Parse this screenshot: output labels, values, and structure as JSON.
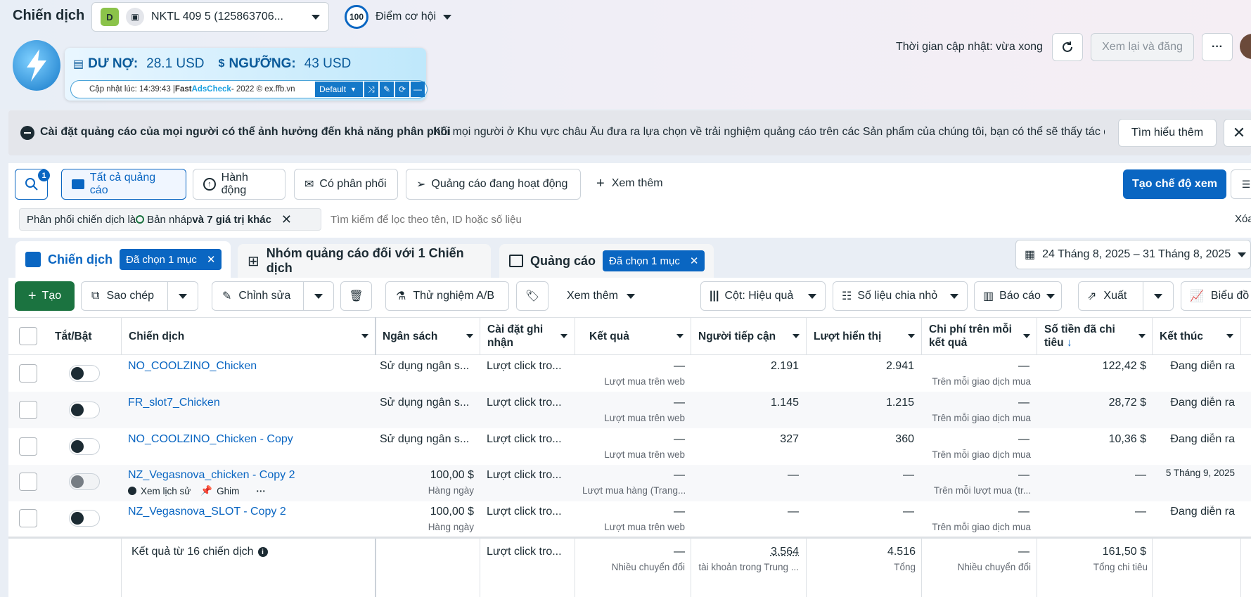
{
  "header": {
    "title": "Chiến dịch",
    "account_badge": "D",
    "account_name": "NKTL 409 5 (125863706...",
    "score_value": "100",
    "score_label": "Điểm cơ hội",
    "update_time": "Thời gian cập nhật: vừa xong",
    "review_button": "Xem lại và đăng"
  },
  "adscheck": {
    "debt_label": "DƯ NỢ:",
    "debt_value": "28.1 USD",
    "threshold_label": "NGƯỠNG:",
    "threshold_value": "43 USD",
    "updated_text": "Cập nhật lúc: 14:39:43 | ",
    "brand_fast": "Fast ",
    "brand_name": "AdsCheck",
    "brand_tail": " - 2022 © ex.ffb.vn",
    "mode": "Default"
  },
  "notice": {
    "title": "Cài đặt quảng cáo của mọi người có thể ảnh hưởng đến khả năng phân phối",
    "text": "Khi mọi người ở Khu vực châu Âu đưa ra lựa chọn về trải nghiệm quảng cáo trên các Sản phẩm của chúng tôi, bạn có thể sẽ thấy tác đ...",
    "learn_more": "Tìm hiểu thêm"
  },
  "filters": {
    "search_badge": "1",
    "all_ads": "Tất cả quảng cáo",
    "actions": "Hành động",
    "delivering": "Có phân phối",
    "active_ads": "Quảng cáo đang hoạt động",
    "more": "Xem thêm",
    "create_view": "Tạo chế độ xem"
  },
  "chip": {
    "prefix": "Phân phối chiến dịch là ",
    "value": "Bản nháp",
    "suffix": " và 7 giá trị khác"
  },
  "search": {
    "placeholder": "Tìm kiếm để lọc theo tên, ID hoặc số liệu",
    "clear": "Xóa"
  },
  "tabs": {
    "campaign": "Chiến dịch",
    "campaign_selected": "Đã chọn 1 mục",
    "adset": "Nhóm quảng cáo đối với 1 Chiến dịch",
    "ads": "Quảng cáo",
    "ads_selected": "Đã chọn 1 mục",
    "date_range": "24 Tháng 8, 2025 – 31 Tháng 8, 2025"
  },
  "toolbar": {
    "create": "Tạo",
    "copy": "Sao chép",
    "edit": "Chỉnh sửa",
    "ab_test": "Thử nghiệm A/B",
    "more": "Xem thêm",
    "columns": "Cột: Hiệu quả",
    "breakdown": "Số liệu chia nhỏ",
    "reports": "Báo cáo",
    "export": "Xuất",
    "chart": "Biểu đồ"
  },
  "columns": {
    "toggle": "Tắt/Bật",
    "campaign": "Chiến dịch",
    "budget": "Ngân sách",
    "attribution": "Cài đặt ghi nhận",
    "results": "Kết quả",
    "reach": "Người tiếp cận",
    "impressions": "Lượt hiển thị",
    "cost_per_result": "Chi phí trên mỗi kết quả",
    "amount_spent": "Số tiền đã chi tiêu",
    "end": "Kết thúc"
  },
  "rows": [
    {
      "name": "NO_COOLZINO_Chicken",
      "budget": "Sử dụng ngân s...",
      "budget_sub": "",
      "attribution": "Lượt click tro...",
      "result": "—",
      "result_sub": "Lượt mua trên web",
      "reach": "2.191",
      "impressions": "2.941",
      "cpr": "—",
      "cpr_sub": "Trên mỗi giao dịch mua",
      "spent": "122,42 $",
      "end": "Đang diễn ra"
    },
    {
      "name": "FR_slot7_Chicken",
      "budget": "Sử dụng ngân s...",
      "budget_sub": "",
      "attribution": "Lượt click tro...",
      "result": "—",
      "result_sub": "Lượt mua trên web",
      "reach": "1.145",
      "impressions": "1.215",
      "cpr": "—",
      "cpr_sub": "Trên mỗi giao dịch mua",
      "spent": "28,72 $",
      "end": "Đang diễn ra"
    },
    {
      "name": "NO_COOLZINO_Chicken - Copy",
      "budget": "Sử dụng ngân s...",
      "budget_sub": "",
      "attribution": "Lượt click tro...",
      "result": "—",
      "result_sub": "Lượt mua trên web",
      "reach": "327",
      "impressions": "360",
      "cpr": "—",
      "cpr_sub": "Trên mỗi giao dịch mua",
      "spent": "10,36 $",
      "end": "Đang diễn ra"
    },
    {
      "name": "NZ_Vegasnova_chicken - Copy 2",
      "budget": "100,00 $",
      "budget_sub": "Hàng ngày",
      "attribution": "Lượt click tro...",
      "result": "—",
      "result_sub": "Lượt mua hàng (Trang...",
      "reach": "—",
      "impressions": "—",
      "cpr": "—",
      "cpr_sub": "Trên mỗi lượt mua (tr...",
      "spent": "—",
      "end": "5 Tháng 9, 2025",
      "history": "Xem lịch sử",
      "pin": "Ghim"
    },
    {
      "name": "NZ_Vegasnova_SLOT - Copy 2",
      "budget": "100,00 $",
      "budget_sub": "Hàng ngày",
      "attribution": "Lượt click tro...",
      "result": "—",
      "result_sub": "Lượt mua trên web",
      "reach": "—",
      "impressions": "—",
      "cpr": "—",
      "cpr_sub": "Trên mỗi giao dịch mua",
      "spent": "—",
      "end": "Đang diễn ra"
    }
  ],
  "summary": {
    "label": "Kết quả từ 16 chiến dịch",
    "attribution": "Lượt click tro...",
    "result": "—",
    "result_sub": "Nhiều chuyển đổi",
    "reach": "3.564",
    "reach_sub": "tài khoản trong Trung ...",
    "impressions": "4.516",
    "impressions_sub": "Tổng",
    "cpr": "—",
    "cpr_sub": "Nhiều chuyển đổi",
    "spent": "161,50 $",
    "spent_sub": "Tổng chi tiêu"
  },
  "colors": {
    "accent": "#0a66c2",
    "create_green": "#1b7340",
    "link": "#1d65c1"
  }
}
